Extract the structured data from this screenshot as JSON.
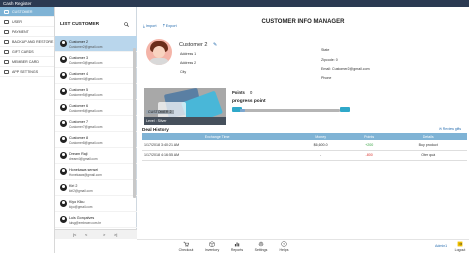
{
  "window": {
    "title": "Cash Register"
  },
  "nav": {
    "items": [
      {
        "label": "CUSTOMER",
        "icon": "user-icon",
        "active": true
      },
      {
        "label": "USER",
        "icon": "user-icon"
      },
      {
        "label": "PAYMENT",
        "icon": "card-icon"
      },
      {
        "label": "BACKUP AND RESTORE",
        "icon": "database-icon"
      },
      {
        "label": "GIFT CARDS",
        "icon": "gift-icon"
      },
      {
        "label": "MEMBER CARD",
        "icon": "card-icon"
      },
      {
        "label": "APP SETTINGS",
        "icon": "gear-icon"
      }
    ]
  },
  "list": {
    "title": "LIST CUSTOMER",
    "search_icon": "search-icon",
    "customers": [
      {
        "name": "Customer 2",
        "email": "Customer2@gmail.com",
        "selected": true
      },
      {
        "name": "Customer 3",
        "email": "Customer3@gmail.com"
      },
      {
        "name": "Customer 4",
        "email": "Customer4@gmail.com"
      },
      {
        "name": "Customer 5",
        "email": "Customer5@gmail.com"
      },
      {
        "name": "Customer 6",
        "email": "Customer6@gmail.com"
      },
      {
        "name": "Customer 7",
        "email": "Customer7@gmail.com"
      },
      {
        "name": "Customer 8",
        "email": "Customer8@gmail.com"
      },
      {
        "name": "Dream Raji",
        "email": "dream4@gmail.com"
      },
      {
        "name": "Honekawa sensei",
        "email": "Honekawa@gmail.com"
      },
      {
        "name": "Kiri 2",
        "email": "kiri2@gmail.com"
      },
      {
        "name": "Kiyo Kiku",
        "email": "kiyo@gmail.com"
      },
      {
        "name": "Luis Gonçalves",
        "email": "luisg@embraer.com.br"
      }
    ],
    "pager": {
      "first": "|<",
      "prev": "<",
      "next": ">",
      "last": ">|"
    }
  },
  "main": {
    "title": "CUSTOMER INFO MANAGER",
    "import_label": "Import",
    "export_label": "Export",
    "customer": {
      "name": "Customer 2",
      "address1": "Address 1",
      "address2": "Address 2",
      "city": "City",
      "state_label": "State",
      "zipcode": "Zipcode: 0",
      "email": "Email:  Customer2@gmail.com",
      "phone_label": "Phone"
    },
    "card": {
      "name": "CUSTOMER 2",
      "level": "Level :  Silver"
    },
    "points": {
      "label": "Points",
      "value": "0",
      "progress_label": "progress point",
      "progress_fraction": 0.05
    },
    "history": {
      "title": "Deal History",
      "review_link": "Review gifts",
      "columns": [
        "Exchange Time",
        "Money",
        "Points",
        "Details"
      ],
      "rows": [
        {
          "time": "1/17/2018 3:40:21 AM",
          "money": "$6,600.0",
          "points": "+200",
          "details": "Buy product",
          "sign": "pos"
        },
        {
          "time": "1/17/2018 4:16:55 AM",
          "money": "-",
          "points": "-800",
          "details": "Oter quà",
          "sign": "neg"
        }
      ]
    }
  },
  "bottom": {
    "items": [
      {
        "label": "Checkout",
        "icon": "cart-icon"
      },
      {
        "label": "Inventory",
        "icon": "box-icon"
      },
      {
        "label": "Reports",
        "icon": "chart-icon"
      },
      {
        "label": "Settings",
        "icon": "gear-icon"
      },
      {
        "label": "Helps",
        "icon": "help-icon"
      }
    ],
    "user": "Admin1",
    "logout_label": "Logout"
  }
}
